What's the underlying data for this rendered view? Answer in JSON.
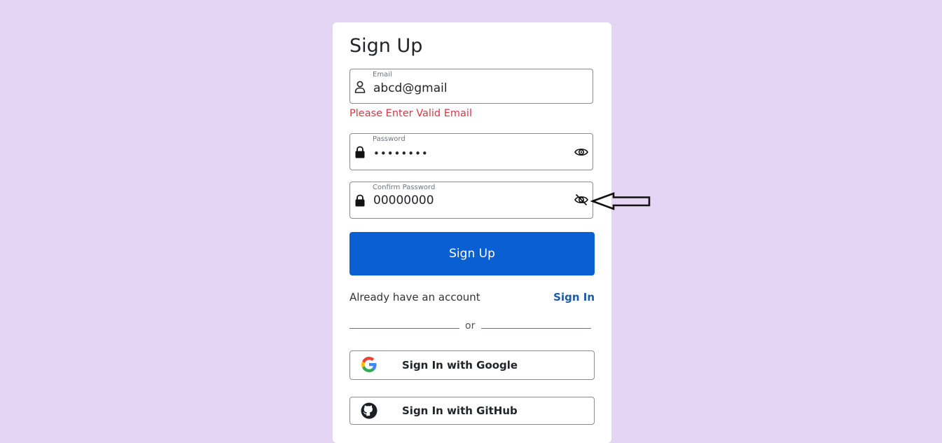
{
  "form": {
    "title": "Sign Up",
    "email": {
      "label": "Email",
      "value": "abcd@gmail",
      "error": "Please Enter Valid Email",
      "icon": "person-icon"
    },
    "password": {
      "label": "Password",
      "value": "••••••••",
      "icon": "lock-icon",
      "toggle_icon": "eye-icon"
    },
    "confirm_password": {
      "label": "Confirm Password",
      "value": "00000000",
      "icon": "lock-icon",
      "toggle_icon": "eye-slash-icon"
    },
    "submit_label": "Sign Up",
    "account_prompt": "Already have an account",
    "signin_link": "Sign In",
    "divider_text": "or",
    "google_button": {
      "label": "Sign In with Google",
      "icon": "google-icon"
    },
    "github_button": {
      "label": "Sign In with GitHub",
      "icon": "github-icon"
    }
  },
  "colors": {
    "background": "#e5d5f5",
    "primary": "#0a5fd3",
    "error": "#dc3545",
    "link": "#1d5aa8"
  }
}
